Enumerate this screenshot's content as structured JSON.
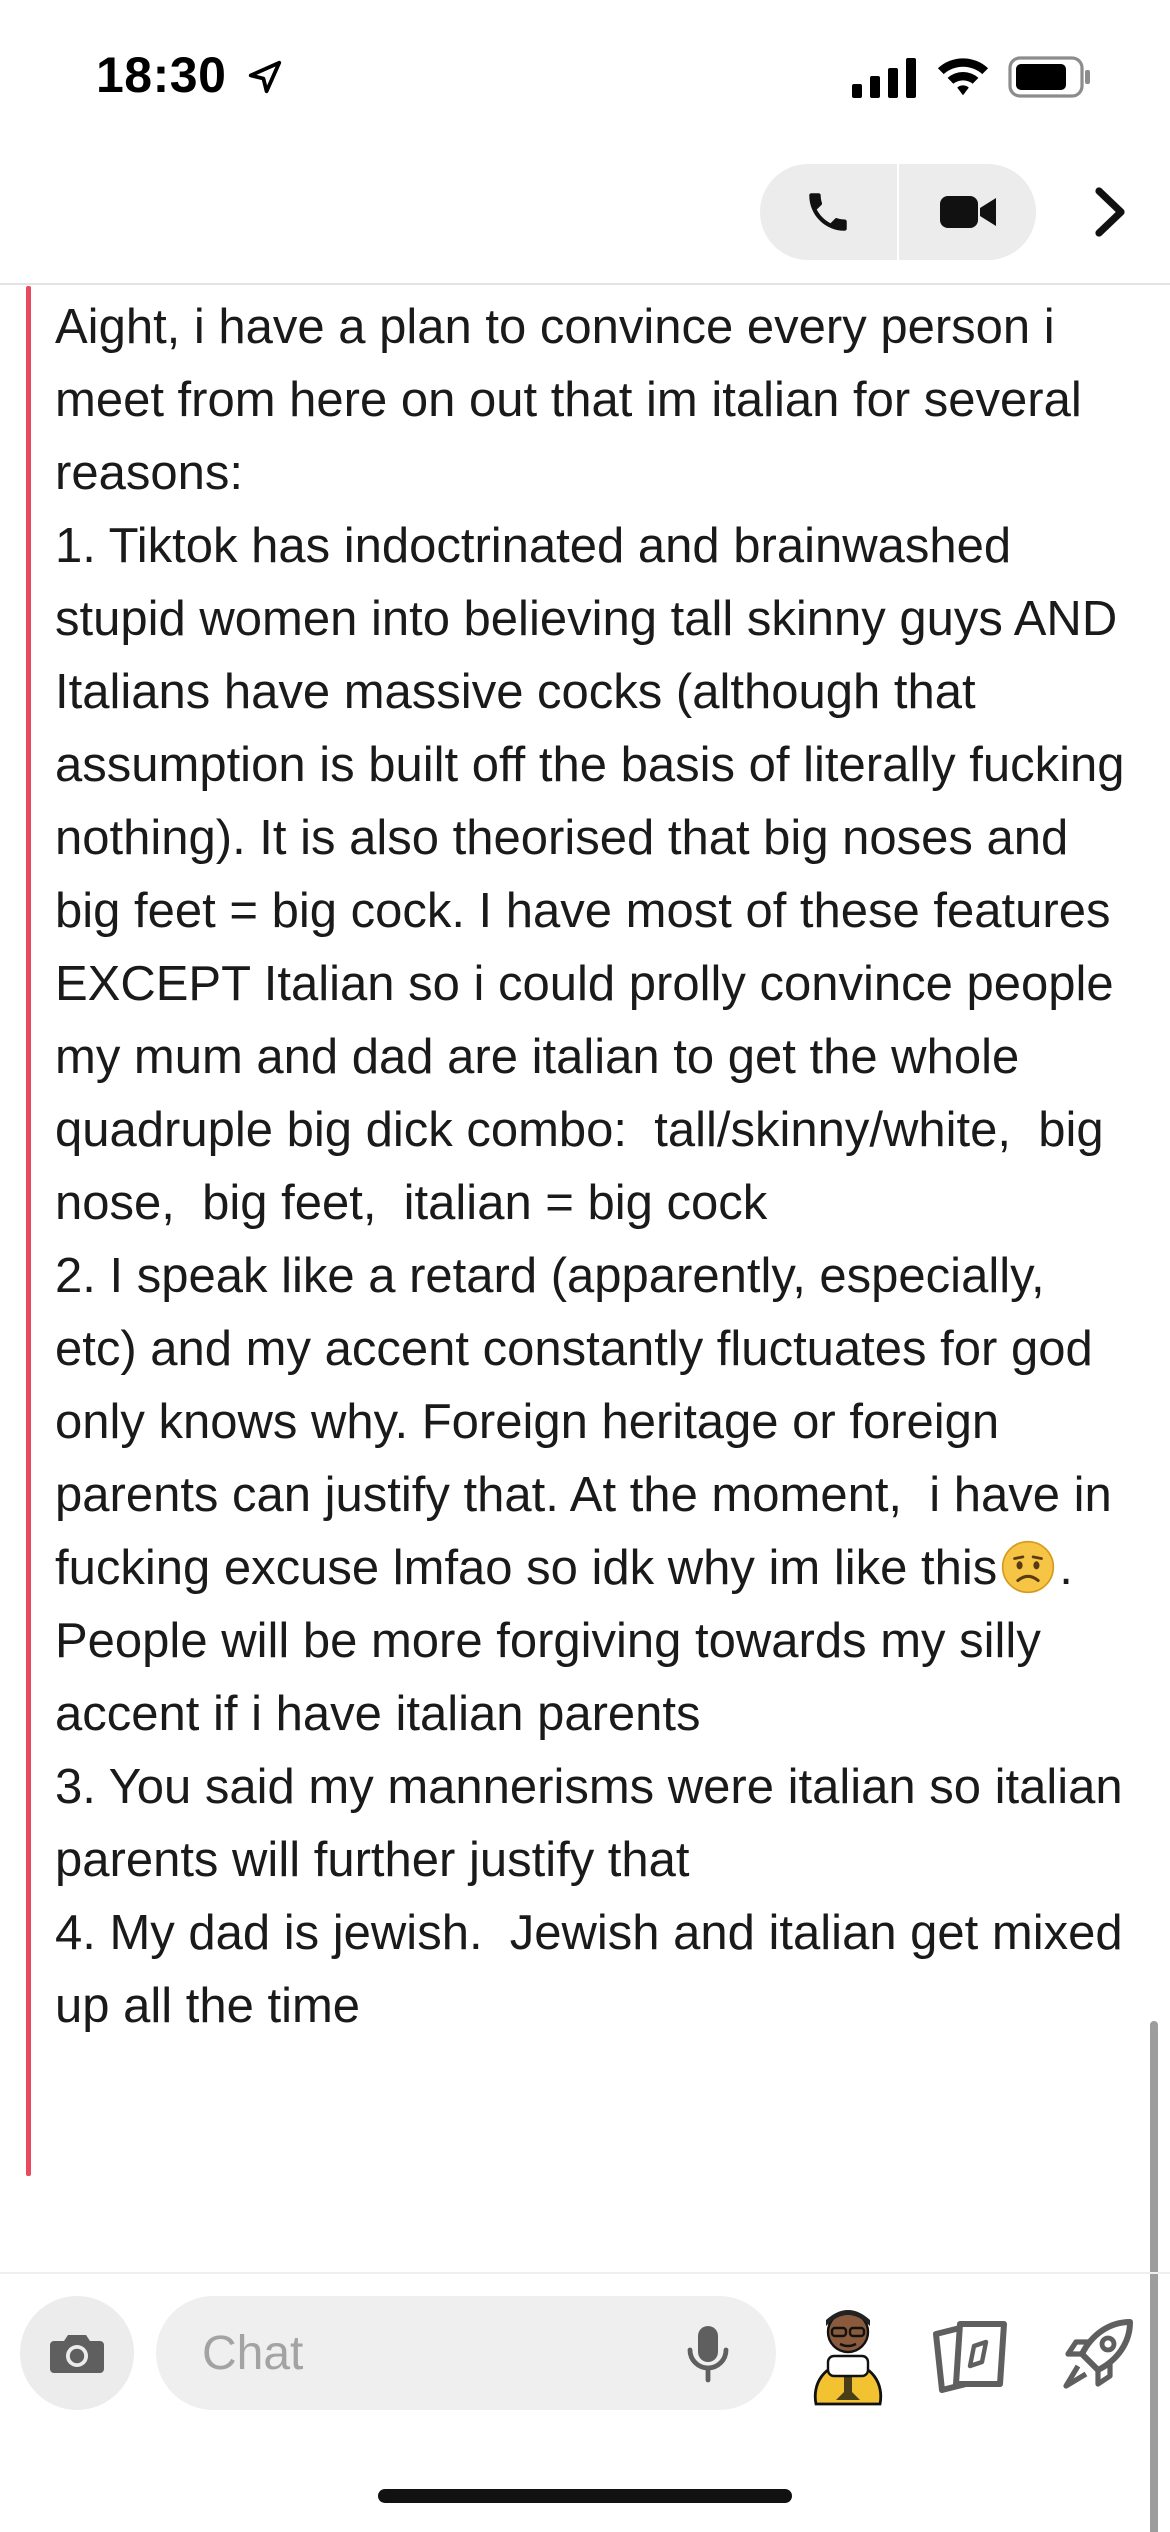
{
  "status_bar": {
    "time": "18:30",
    "icons": [
      "location-arrow-icon",
      "cellular-signal-icon",
      "wifi-icon",
      "battery-icon"
    ]
  },
  "header": {
    "buttons": [
      "phone-icon",
      "video-camera-icon",
      "chevron-right-icon"
    ]
  },
  "message": {
    "accent_color": "#e84a5f",
    "part1": "Aight, i have a plan to convince every person i meet from here on out that im italian for several reasons:\n1. Tiktok has indoctrinated and brainwashed stupid women into believing tall skinny guys AND Italians have massive cocks (although that assumption is built off the basis of literally fucking nothing). It is also theorised that big noses and big feet = big cock. I have most of these features EXCEPT Italian so i could prolly convince people my mum and dad are italian to get the whole quadruple big dick combo:  tall/skinny/white,  big nose,  big feet,  italian = big cock\n2. I speak like a retard (apparently, especially, etc) and my accent constantly fluctuates for god only knows why. Foreign heritage or foreign parents can justify that. At the moment,  i have in fucking excuse lmfao so idk why im like this",
    "emoji": "worried-face-icon",
    "part2": ".  People will be more forgiving towards my silly accent if i have italian parents\n3. You said my mannerisms were italian so italian parents will further justify that\n4. My dad is jewish.  Jewish and italian get mixed up all the time"
  },
  "composer": {
    "placeholder": "Chat",
    "icons": [
      "camera-icon",
      "microphone-icon",
      "bitmoji-avatar-icon",
      "cards-icon",
      "rocket-icon"
    ]
  }
}
